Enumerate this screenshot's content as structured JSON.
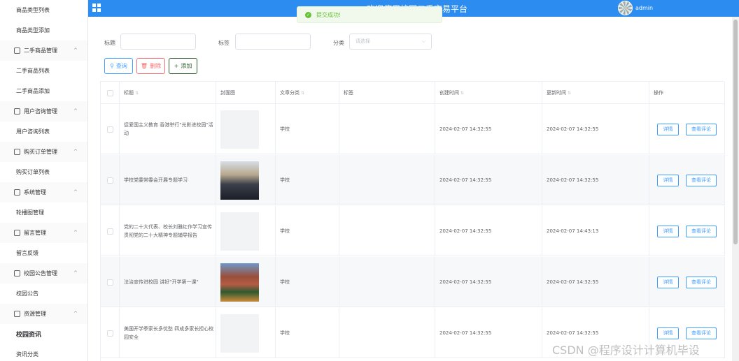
{
  "sidebar": {
    "items": [
      {
        "label": "商品类型列表",
        "type": "item"
      },
      {
        "label": "商品类型添加",
        "type": "item"
      },
      {
        "label": "二手商品管理",
        "type": "group"
      },
      {
        "label": "二手商品列表",
        "type": "item"
      },
      {
        "label": "二手商品添加",
        "type": "item"
      },
      {
        "label": "用户咨询管理",
        "type": "group"
      },
      {
        "label": "用户咨询列表",
        "type": "item"
      },
      {
        "label": "购买订单管理",
        "type": "group"
      },
      {
        "label": "购买订单列表",
        "type": "item"
      },
      {
        "label": "系统管理",
        "type": "group"
      },
      {
        "label": "轮播图管理",
        "type": "item"
      },
      {
        "label": "留言管理",
        "type": "group"
      },
      {
        "label": "留言反馈",
        "type": "item"
      },
      {
        "label": "校园公告管理",
        "type": "group"
      },
      {
        "label": "校园公告",
        "type": "item"
      },
      {
        "label": "资源管理",
        "type": "group"
      },
      {
        "label": "校园资讯",
        "type": "active"
      },
      {
        "label": "资讯分类",
        "type": "item"
      }
    ]
  },
  "header": {
    "title": "欢迎使用校园二手交易平台",
    "user": "admin",
    "accent": "#2d8cf0"
  },
  "toast": {
    "message": "提交成功!",
    "color": "#67c23a"
  },
  "filters": {
    "title_label": "标题",
    "tag_label": "标签",
    "category_label": "分类",
    "category_placeholder": "请选择"
  },
  "toolbar": {
    "search_label": "查询",
    "delete_label": "删除",
    "add_label": "添加"
  },
  "table": {
    "columns": [
      "标题",
      "封面图",
      "文章分类",
      "标签",
      "创建时间",
      "更新时间",
      "操作"
    ],
    "detail_label": "详情",
    "comments_label": "查看评论",
    "rows": [
      {
        "title": "促爱国主义教育 香港举行\"光影进校园\"活动",
        "cover": "none",
        "category": "学校",
        "tag": "",
        "created": "2024-02-07 14:32:55",
        "updated": "2024-02-07 14:32:55"
      },
      {
        "title": "学校党委常委会开展专题学习",
        "cover": "photo1",
        "category": "学校",
        "tag": "",
        "created": "2024-02-07 14:32:55",
        "updated": "2024-02-07 14:32:55"
      },
      {
        "title": "党的二十大代表、校长刘雅红作学习宣传贯彻党的二十大精神专题辅导报告",
        "cover": "none",
        "category": "学校",
        "tag": "",
        "created": "2024-02-07 14:32:55",
        "updated": "2024-02-07 14:43:13"
      },
      {
        "title": "法治宣传进校园 讲好\"开学第一课\"",
        "cover": "photo2",
        "category": "学校",
        "tag": "",
        "created": "2024-02-07 14:32:55",
        "updated": "2024-02-07 14:32:55"
      },
      {
        "title": "美国开学季家长多忧愁 四成多家长担心校园安全",
        "cover": "none",
        "category": "学校",
        "tag": "",
        "created": "2024-02-07 14:32:55",
        "updated": "2024-02-07 14:32:55"
      }
    ]
  },
  "watermark": "CSDN @程序设计计算机毕设"
}
